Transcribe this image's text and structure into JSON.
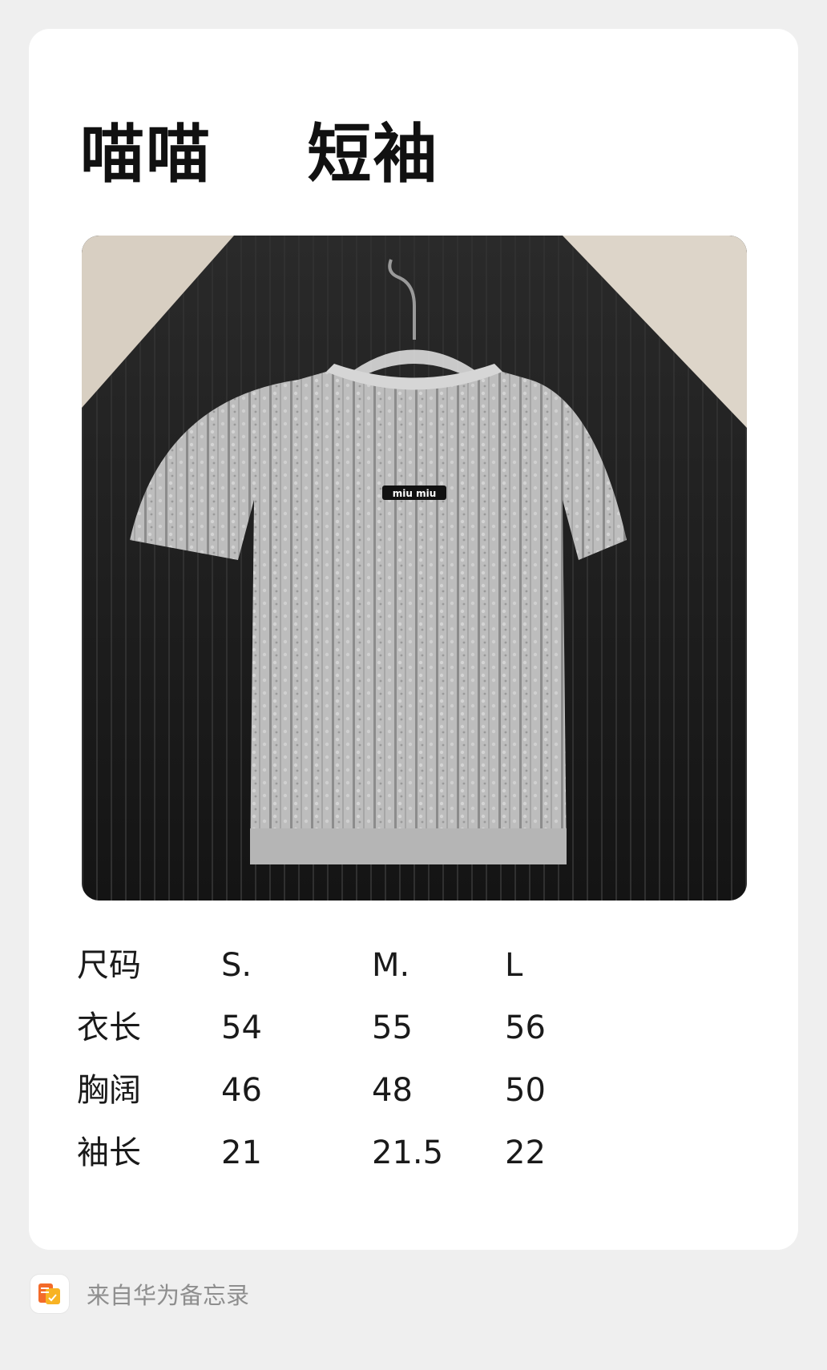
{
  "note": {
    "title": "喵喵    短袖",
    "photo_icon": "knit-tshirt-on-hanger-photo",
    "label_text": "miu miu"
  },
  "size_table": {
    "rows": [
      [
        "尺码",
        "S.",
        "M.",
        "L"
      ],
      [
        "衣长",
        "54",
        "55",
        "56"
      ],
      [
        "胸阔",
        "46",
        "48",
        "50"
      ],
      [
        "袖长",
        "21",
        "21.5",
        "22"
      ]
    ]
  },
  "footer": {
    "app_icon": "huawei-notes-icon",
    "source_text": "来自华为备忘录",
    "accent_colors": [
      "#f36b2a",
      "#f8b323"
    ]
  }
}
